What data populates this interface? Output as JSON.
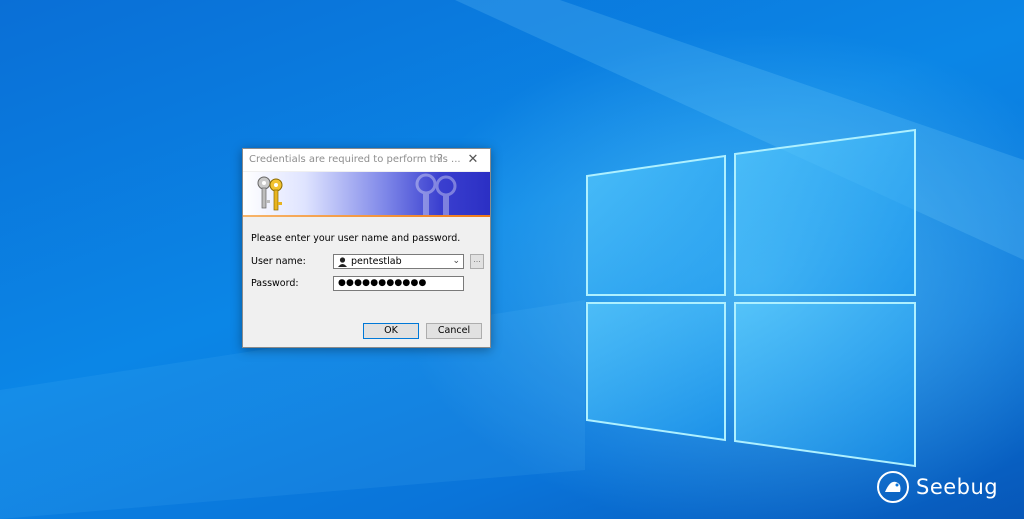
{
  "dialog": {
    "title": "Credentials are required to perform this ...",
    "help_label": "?",
    "close_label": "✕",
    "prompt": "Please enter your user name and password.",
    "username_label": "User name:",
    "username_value": "pentestlab",
    "browse_label": "...",
    "password_label": "Password:",
    "password_value": "●●●●●●●●●●●",
    "ok_label": "OK",
    "cancel_label": "Cancel"
  },
  "watermark": {
    "text": "Seebug"
  },
  "colors": {
    "desktop": "#0b86e6",
    "banner_end": "#2b2fc4",
    "accent_line": "#f07a18",
    "ok_border": "#0078d7"
  },
  "icons": [
    "keys-icon",
    "user-icon",
    "chevron-down-icon",
    "close-icon",
    "help-icon",
    "windows-logo",
    "seebug-logo"
  ]
}
